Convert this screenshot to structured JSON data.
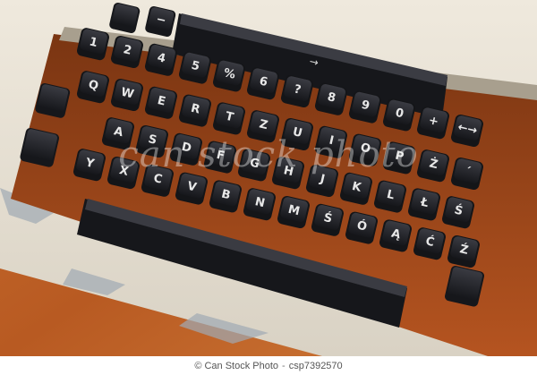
{
  "image": {
    "subject": "typewriter keyboard",
    "colors": {
      "wood": "#c76a2c",
      "wood_dark": "#8b3e12",
      "body_cream": "#e8e1d4",
      "key_black": "#1e1f24",
      "key_top": "#2f3037",
      "legend": "#e8e8e8"
    },
    "rows": [
      {
        "keys": [
          "1",
          "2",
          "4",
          "5",
          "%",
          "6",
          "?",
          "8",
          "9",
          "0",
          "+",
          "←→"
        ]
      },
      {
        "keys": [
          "Q",
          "W",
          "E",
          "R",
          "T",
          "Z",
          "U",
          "I",
          "O",
          "P",
          "Ż",
          "´"
        ]
      },
      {
        "keys": [
          "A",
          "S",
          "D",
          "F",
          "G",
          "H",
          "J",
          "K",
          "L",
          "Ł",
          "Ś"
        ]
      },
      {
        "keys": [
          "Y",
          "X",
          "C",
          "V",
          "B",
          "N",
          "M",
          "Ś",
          "Ó",
          "Ą",
          "Ć",
          "Ź"
        ]
      }
    ],
    "top_keys": [
      "−"
    ],
    "tab_key_label": "→"
  },
  "watermark": "can stock photo",
  "footer": {
    "copyright": "© Can Stock Photo",
    "separator": "-",
    "id": "csp7392570"
  }
}
